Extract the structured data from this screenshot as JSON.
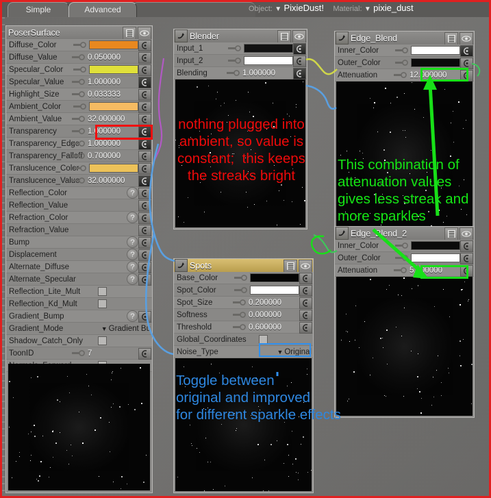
{
  "tabs": [
    {
      "label": "Simple",
      "active": false
    },
    {
      "label": "Advanced",
      "active": true
    }
  ],
  "header": {
    "object_label": "Object:",
    "object_value": "PixieDust!",
    "material_label": "Material:",
    "material_value": "pixie_dust",
    "caret": "▼"
  },
  "poser_surface": {
    "title": "PoserSurface",
    "rows": [
      {
        "label": "Diffuse_Color",
        "type": "swatch",
        "color": "#e8881f",
        "plug": true
      },
      {
        "label": "Diffuse_Value",
        "type": "number",
        "value": "0.050000",
        "plug": true
      },
      {
        "label": "Specular_Color",
        "type": "swatch",
        "color": "#e0e03a",
        "plug": true
      },
      {
        "label": "Specular_Value",
        "type": "number",
        "value": "1.000000",
        "plug": true,
        "dark_end": true
      },
      {
        "label": "Highlight_Size",
        "type": "number",
        "value": "0.033333",
        "plug": true
      },
      {
        "label": "Ambient_Color",
        "type": "swatch",
        "color": "#f5bb62",
        "plug": true
      },
      {
        "label": "Ambient_Value",
        "type": "number",
        "value": "32.000000",
        "plug": true,
        "highlight": "red"
      },
      {
        "label": "Transparency",
        "type": "number",
        "value": "1.000000",
        "plug": true,
        "dark_end": true
      },
      {
        "label": "Transparency_Edge",
        "type": "number",
        "value": "1.000000",
        "plug": true,
        "dark_end": true
      },
      {
        "label": "Transparency_Falloff",
        "type": "number",
        "value": "0.700000",
        "plug": true
      },
      {
        "label": "Translucence_Color",
        "type": "swatch",
        "color": "#edc259",
        "plug": true
      },
      {
        "label": "Translucence_Value",
        "type": "number",
        "value": "32.000000",
        "plug": true,
        "dark_end": true
      },
      {
        "label": "Reflection_Color",
        "type": "qmark",
        "value": "?"
      },
      {
        "label": "Reflection_Value",
        "type": "empty"
      },
      {
        "label": "Refraction_Color",
        "type": "qmark",
        "value": "?"
      },
      {
        "label": "Refraction_Value",
        "type": "empty"
      },
      {
        "label": "Bump",
        "type": "qmark",
        "value": "?"
      },
      {
        "label": "Displacement",
        "type": "qmark",
        "value": "?"
      },
      {
        "label": "Alternate_Diffuse",
        "type": "qmark",
        "value": "?"
      },
      {
        "label": "Alternate_Specular",
        "type": "qmark",
        "value": "?"
      },
      {
        "label": "Reflection_Lite_Mult",
        "type": "checkbox",
        "checked": false,
        "no_end": true
      },
      {
        "label": "Reflection_Kd_Mult",
        "type": "checkbox",
        "checked": false,
        "no_end": true
      },
      {
        "label": "Gradient_Bump",
        "type": "qmark",
        "value": "?"
      },
      {
        "label": "Gradient_Mode",
        "type": "dropdown",
        "value": "Gradient Bu",
        "no_end": true
      },
      {
        "label": "Shadow_Catch_Only",
        "type": "checkbox",
        "checked": false,
        "no_end": true
      },
      {
        "label": "ToonID",
        "type": "number",
        "value": "7",
        "plug": true
      },
      {
        "label": "Normals_Forward",
        "type": "checkbox",
        "checked": false,
        "no_end": true
      }
    ]
  },
  "blender_node": {
    "title": "Blender",
    "rows": [
      {
        "label": "Input_1",
        "type": "swatch",
        "color": "#121212",
        "plug": true,
        "dark_end": true
      },
      {
        "label": "Input_2",
        "type": "swatch",
        "color": "#ffffff",
        "plug": true
      },
      {
        "label": "Blending",
        "type": "number",
        "value": "1.000000",
        "plug": true,
        "dark_end": true
      }
    ]
  },
  "edge_blend_node": {
    "title": "Edge_Blend",
    "rows": [
      {
        "label": "Inner_Color",
        "type": "swatch",
        "color": "#ffffff",
        "plug": true,
        "dark_end": true
      },
      {
        "label": "Outer_Color",
        "type": "swatch",
        "color": "#0a0a0a",
        "plug": true
      },
      {
        "label": "Attenuation",
        "type": "number",
        "value": "12.000000",
        "plug": true,
        "highlight": "green"
      }
    ]
  },
  "edge_blend_2_node": {
    "title": "Edge_Blend_2",
    "rows": [
      {
        "label": "Inner_Color",
        "type": "swatch",
        "color": "#0a0a0a",
        "plug": true
      },
      {
        "label": "Outer_Color",
        "type": "swatch",
        "color": "#ffffff",
        "plug": true
      },
      {
        "label": "Attenuation",
        "type": "number",
        "value": "5.000000",
        "plug": true,
        "highlight": "green"
      }
    ]
  },
  "spots_node": {
    "title": "Spots",
    "rows": [
      {
        "label": "Base_Color",
        "type": "swatch",
        "color": "#050505",
        "plug": true
      },
      {
        "label": "Spot_Color",
        "type": "swatch",
        "color": "#ffffff",
        "plug": true
      },
      {
        "label": "Spot_Size",
        "type": "number",
        "value": "0.200000",
        "plug": true
      },
      {
        "label": "Softness",
        "type": "number",
        "value": "0.000000",
        "plug": true
      },
      {
        "label": "Threshold",
        "type": "number",
        "value": "0.600000",
        "plug": true
      },
      {
        "label": "Global_Coordinates",
        "type": "checkbox",
        "checked": false,
        "no_end": true
      },
      {
        "label": "Noise_Type",
        "type": "dropdown",
        "value": "Original",
        "no_end": true,
        "highlight": "blue"
      }
    ]
  },
  "annotations": {
    "red_note": "nothing plugged into\nambient, so value is\nconstant;  this keeps\nthe streaks bright",
    "green_note": "This combination of\nattenuation values\ngives less streak and\nmore sparkles",
    "blue_note": "Toggle between\noriginal and improved\nfor different sparkle effects"
  },
  "colors": {
    "red_annotation": "#ee0a0a",
    "green_annotation": "#15e515",
    "blue_annotation": "#2e87e0",
    "frame_red": "#e02020",
    "node_header_gold": "#c9ab5c",
    "wire_yellow": "#cfd64a",
    "wire_blue": "#5a9fe0",
    "wire_magenta": "#c060d0",
    "wire_green": "#3ec85a"
  }
}
